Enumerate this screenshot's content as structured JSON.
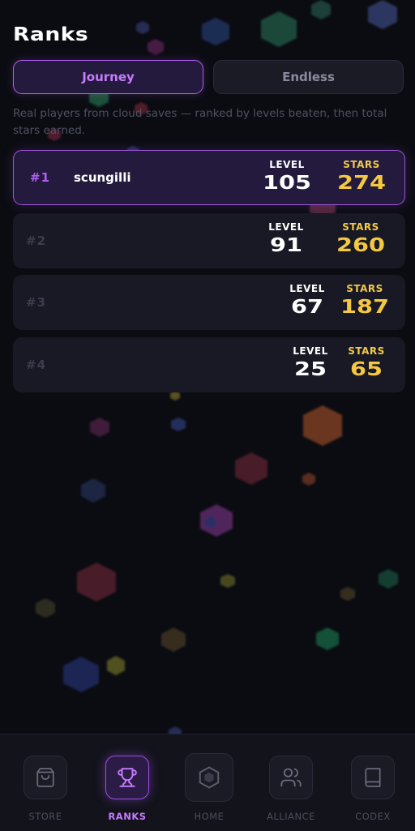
{
  "page_title": "Ranks",
  "tabs": [
    {
      "label": "Journey",
      "active": true
    },
    {
      "label": "Endless",
      "active": false
    }
  ],
  "subtitle": "Real players from cloud saves — ranked by levels beaten, then total stars earned.",
  "stat_labels": {
    "level": "LEVEL",
    "stars": "STARS"
  },
  "leaderboard": [
    {
      "rank": "#1",
      "player": "scungilli",
      "level": "105",
      "stars": "274",
      "is_current_user": true
    },
    {
      "rank": "#2",
      "player": "",
      "level": "91",
      "stars": "260",
      "is_current_user": false
    },
    {
      "rank": "#3",
      "player": "",
      "level": "67",
      "stars": "187",
      "is_current_user": false
    },
    {
      "rank": "#4",
      "player": "",
      "level": "25",
      "stars": "65",
      "is_current_user": false
    }
  ],
  "nav": [
    {
      "label": "STORE",
      "icon": "bag-icon",
      "active": false
    },
    {
      "label": "RANKS",
      "icon": "trophy-icon",
      "active": true
    },
    {
      "label": "HOME",
      "icon": "hexagon-icon",
      "active": false
    },
    {
      "label": "ALLIANCE",
      "icon": "users-icon",
      "active": false
    },
    {
      "label": "CODEX",
      "icon": "book-icon",
      "active": false
    }
  ],
  "colors": {
    "accent": "#b25ef2",
    "stars": "#f5c842",
    "background": "#0b0c12"
  }
}
